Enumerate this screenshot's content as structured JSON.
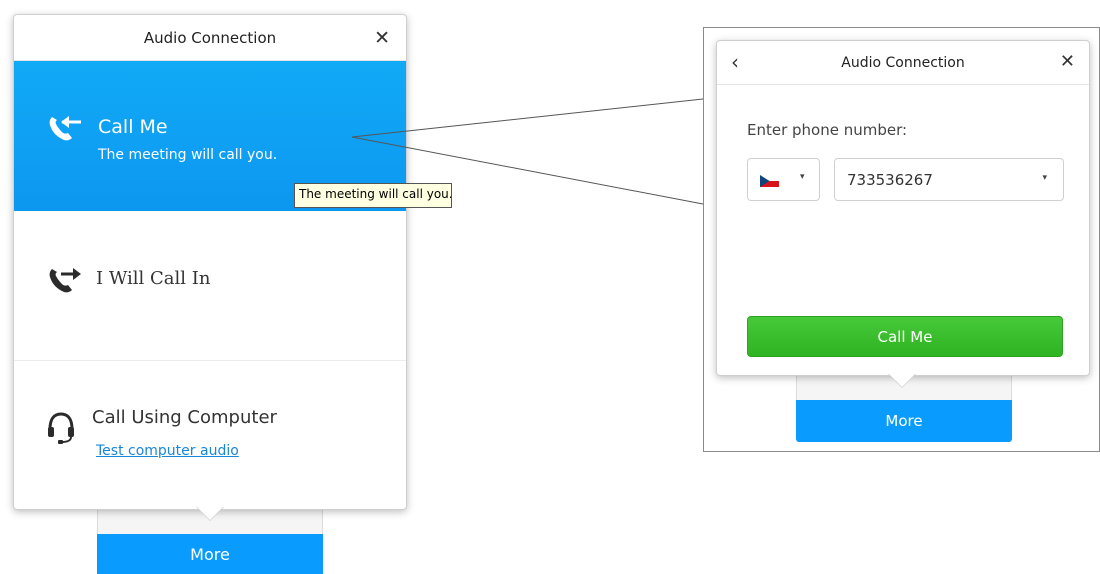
{
  "left_popup": {
    "title": "Audio Connection",
    "close_glyph": "✕",
    "options": [
      {
        "title": "Call Me",
        "subtitle": "The meeting will call you.",
        "icon": "call-me-icon",
        "selected": true
      },
      {
        "title": "I Will Call In",
        "icon": "call-in-icon"
      },
      {
        "title": "Call Using Computer",
        "link": "Test computer audio",
        "icon": "headset-icon"
      }
    ],
    "tooltip": "The meeting will call you."
  },
  "left_more_button": {
    "label": "More"
  },
  "right_popup": {
    "title": "Audio Connection",
    "back_glyph": "‹",
    "close_glyph": "✕",
    "prompt": "Enter phone number:",
    "country": {
      "icon": "czech-flag-icon",
      "caret": "▾"
    },
    "phone": {
      "value": "733536267",
      "caret": "▾"
    },
    "call_button": "Call Me"
  },
  "right_more_button": {
    "label": "More"
  },
  "colors": {
    "accent_blue": "#0a9bff",
    "selected_blue": "#11aaf7",
    "call_green": "#3ac02c",
    "link_blue": "#1a86d8",
    "tooltip_bg": "#ffffe1"
  }
}
